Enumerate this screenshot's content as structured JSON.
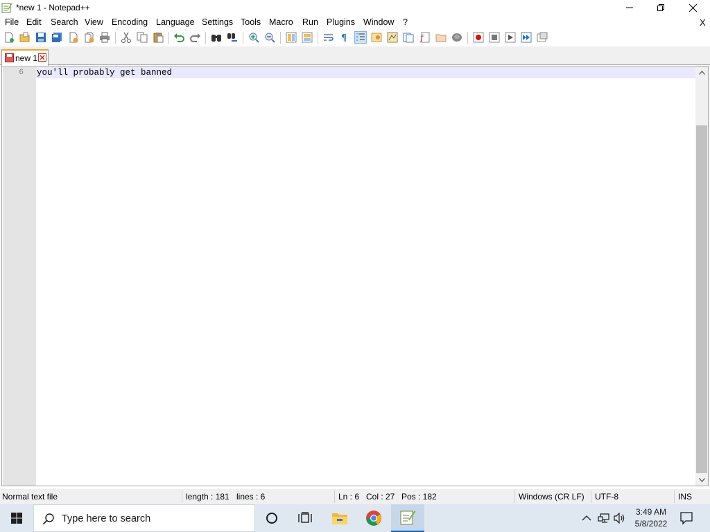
{
  "window": {
    "title": "*new 1 - Notepad++"
  },
  "menu": {
    "items": [
      "File",
      "Edit",
      "Search",
      "View",
      "Encoding",
      "Language",
      "Settings",
      "Tools",
      "Macro",
      "Run",
      "Plugins",
      "Window",
      "?"
    ],
    "close_glyph": "X"
  },
  "toolbar": {
    "icons": [
      "new-file-icon",
      "open-file-icon",
      "save-icon",
      "save-all-icon",
      "close-icon",
      "close-all-icon",
      "print-icon",
      "cut-icon",
      "copy-icon",
      "paste-icon",
      "undo-icon",
      "redo-icon",
      "find-icon",
      "replace-icon",
      "zoom-in-icon",
      "zoom-out-icon",
      "sync-vertical-icon",
      "sync-horizontal-icon",
      "word-wrap-icon",
      "show-all-characters-icon",
      "indent-guide-icon",
      "user-defined-language-icon",
      "document-map-icon",
      "document-list-icon",
      "function-list-icon",
      "folder-as-workspace-icon",
      "monitoring-icon",
      "record-macro-icon",
      "stop-recording-icon",
      "playback-macro-icon",
      "run-macro-multiple-icon",
      "save-macro-icon"
    ]
  },
  "tabs": [
    {
      "label": "new 1",
      "modified": true,
      "active": true
    }
  ],
  "editor": {
    "line_number": "6",
    "line_text": "you'll probably get banned"
  },
  "statusbar": {
    "file_type": "Normal text file",
    "length": "length : 181",
    "lines": "lines : 6",
    "ln": "Ln : 6",
    "col": "Col : 27",
    "pos": "Pos : 182",
    "eol": "Windows (CR LF)",
    "encoding": "UTF-8",
    "mode": "INS"
  },
  "taskbar": {
    "search_placeholder": "Type here to search",
    "time": "3:49 AM",
    "date": "5/8/2022",
    "pinned": [
      "cortana-icon",
      "task-view-icon",
      "file-explorer-icon",
      "chrome-icon",
      "notepad-plus-plus-icon"
    ]
  },
  "colors": {
    "tab_accent": "#f5a623",
    "current_line": "#e8e8ff",
    "gutter": "#e4e4e4",
    "taskbar": "#dfe7f0",
    "taskbar_active_underline": "#0067c0"
  }
}
